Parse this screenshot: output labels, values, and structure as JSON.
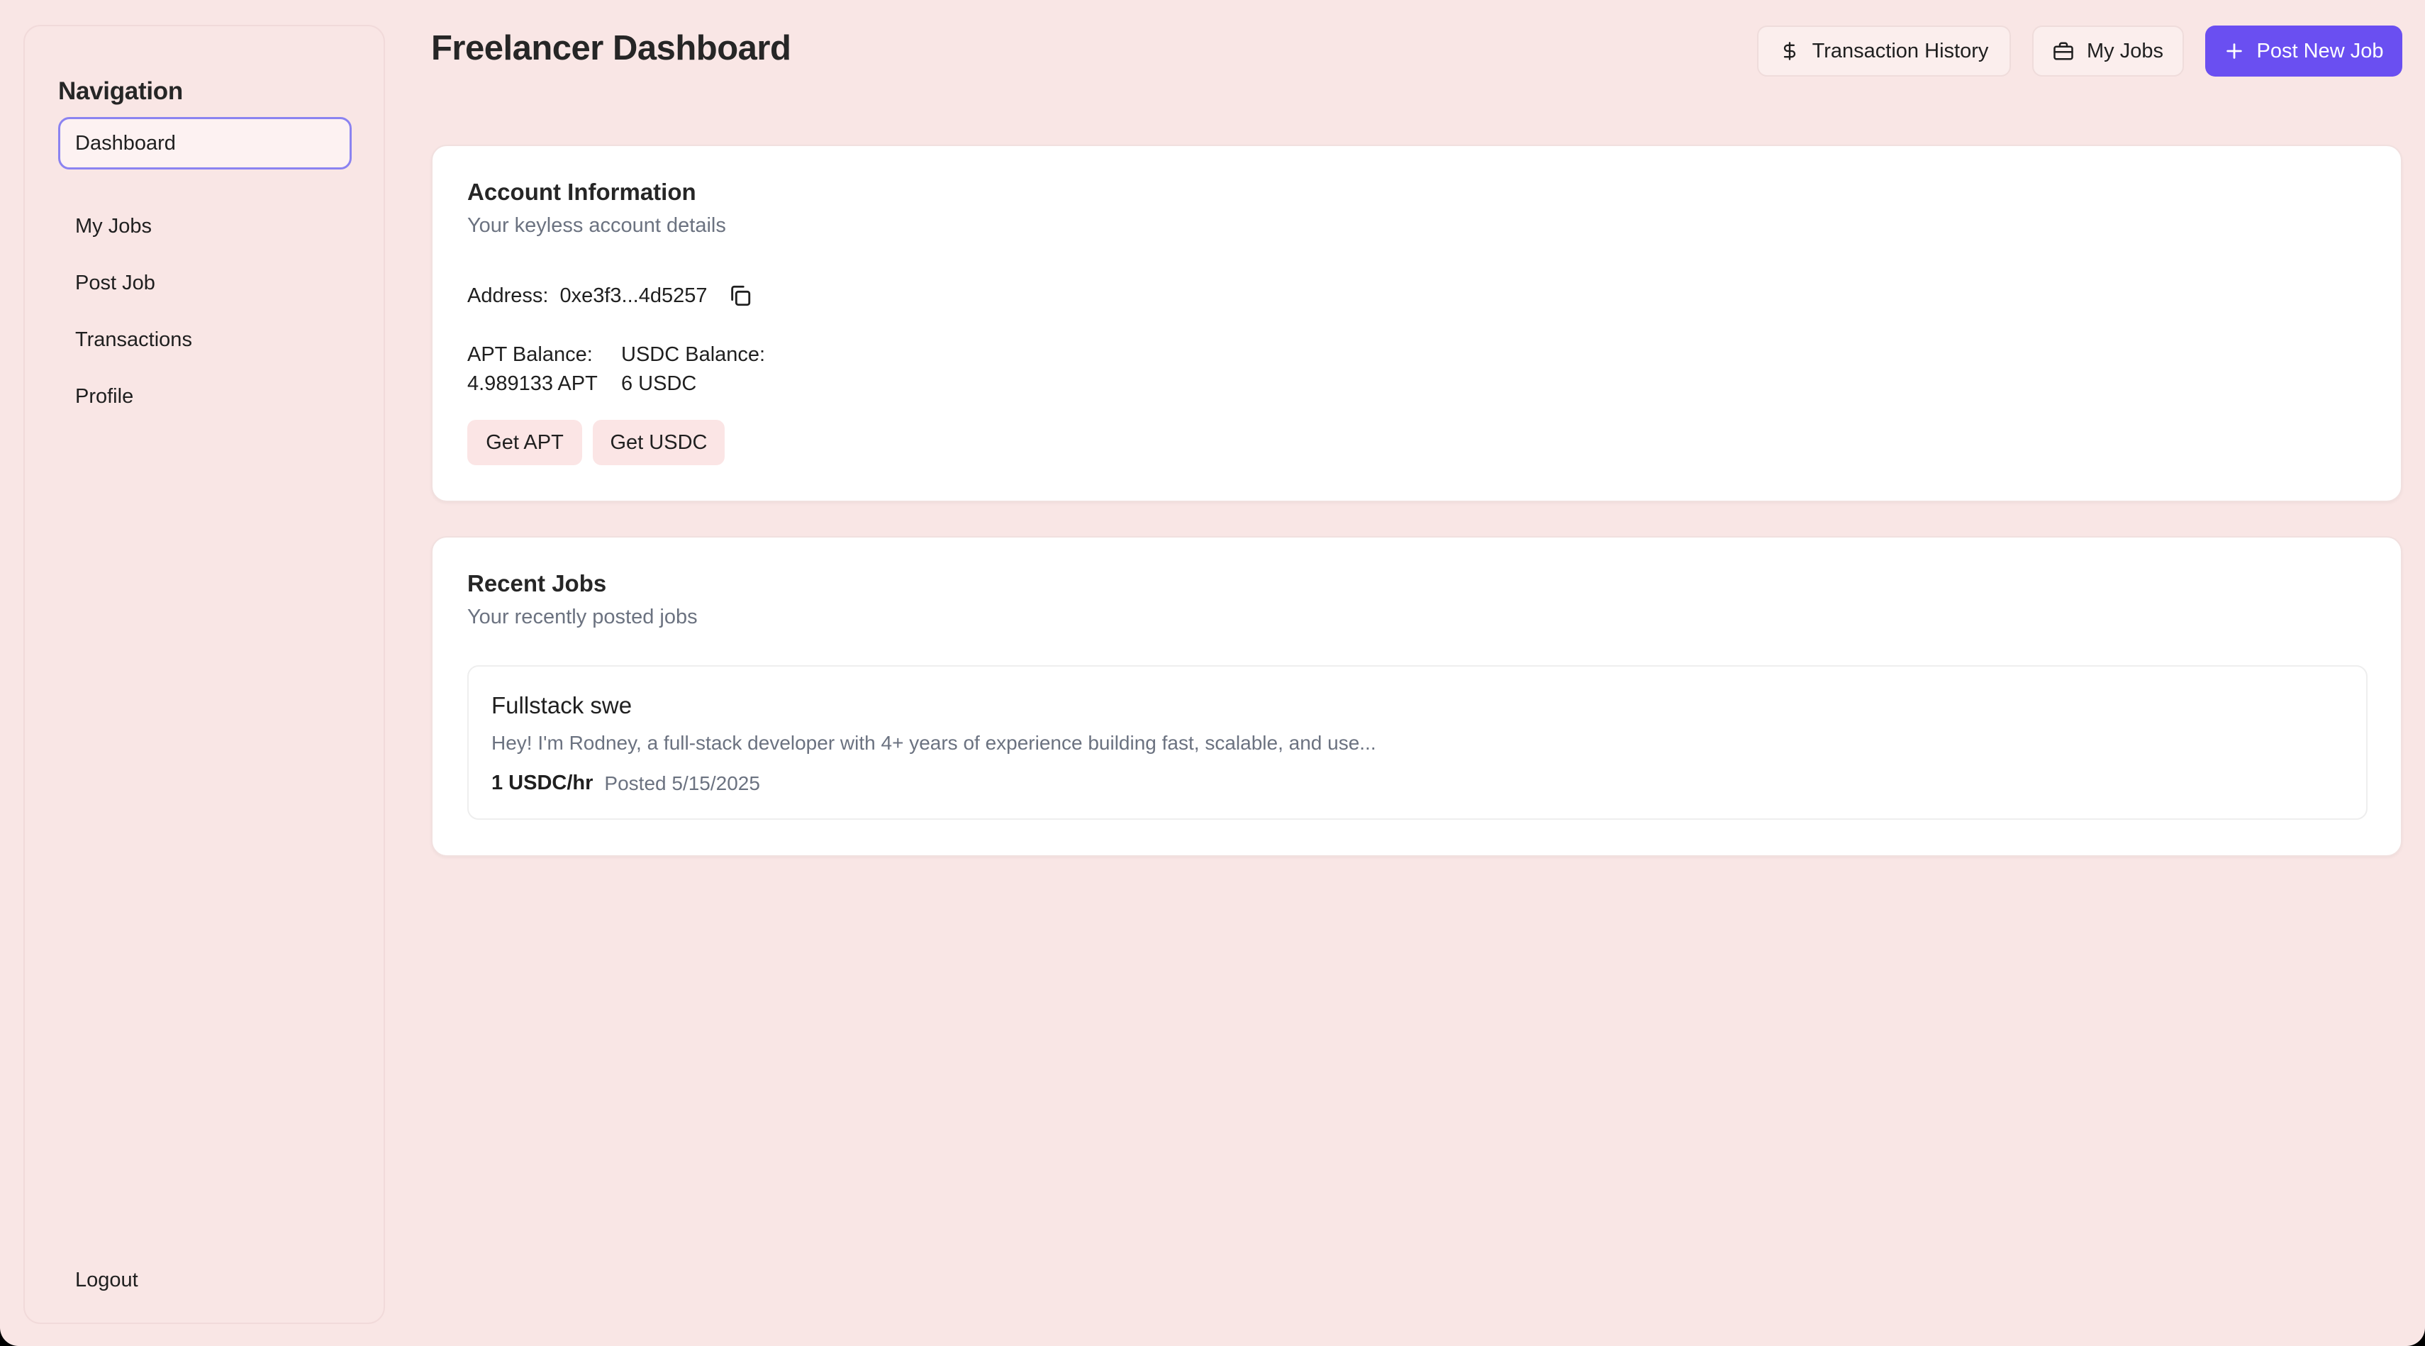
{
  "sidebar": {
    "title": "Navigation",
    "items": [
      {
        "label": "Dashboard"
      },
      {
        "label": "My Jobs"
      },
      {
        "label": "Post Job"
      },
      {
        "label": "Transactions"
      },
      {
        "label": "Profile"
      }
    ],
    "logout_label": "Logout"
  },
  "header": {
    "title": "Freelancer Dashboard",
    "transaction_history_label": "Transaction History",
    "my_jobs_label": "My Jobs",
    "post_new_job_label": "Post New Job"
  },
  "account": {
    "title": "Account Information",
    "subtitle": "Your keyless account details",
    "address_label": "Address:",
    "address_value": "0xe3f3...4d5257",
    "apt_label": "APT Balance:",
    "apt_value": "4.989133 APT",
    "usdc_label": "USDC Balance:",
    "usdc_value": "6 USDC",
    "get_apt_label": "Get APT",
    "get_usdc_label": "Get USDC"
  },
  "recent_jobs": {
    "title": "Recent Jobs",
    "subtitle": "Your recently posted jobs",
    "jobs": [
      {
        "title": "Fullstack swe",
        "description": "Hey! I'm Rodney, a full-stack developer with 4+ years of experience building fast, scalable, and use...",
        "rate": "1 USDC/hr",
        "posted": "Posted 5/15/2025"
      }
    ]
  },
  "colors": {
    "background": "#f9e6e5",
    "accent": "#6a4ff1",
    "active_border": "#8b83f1"
  }
}
